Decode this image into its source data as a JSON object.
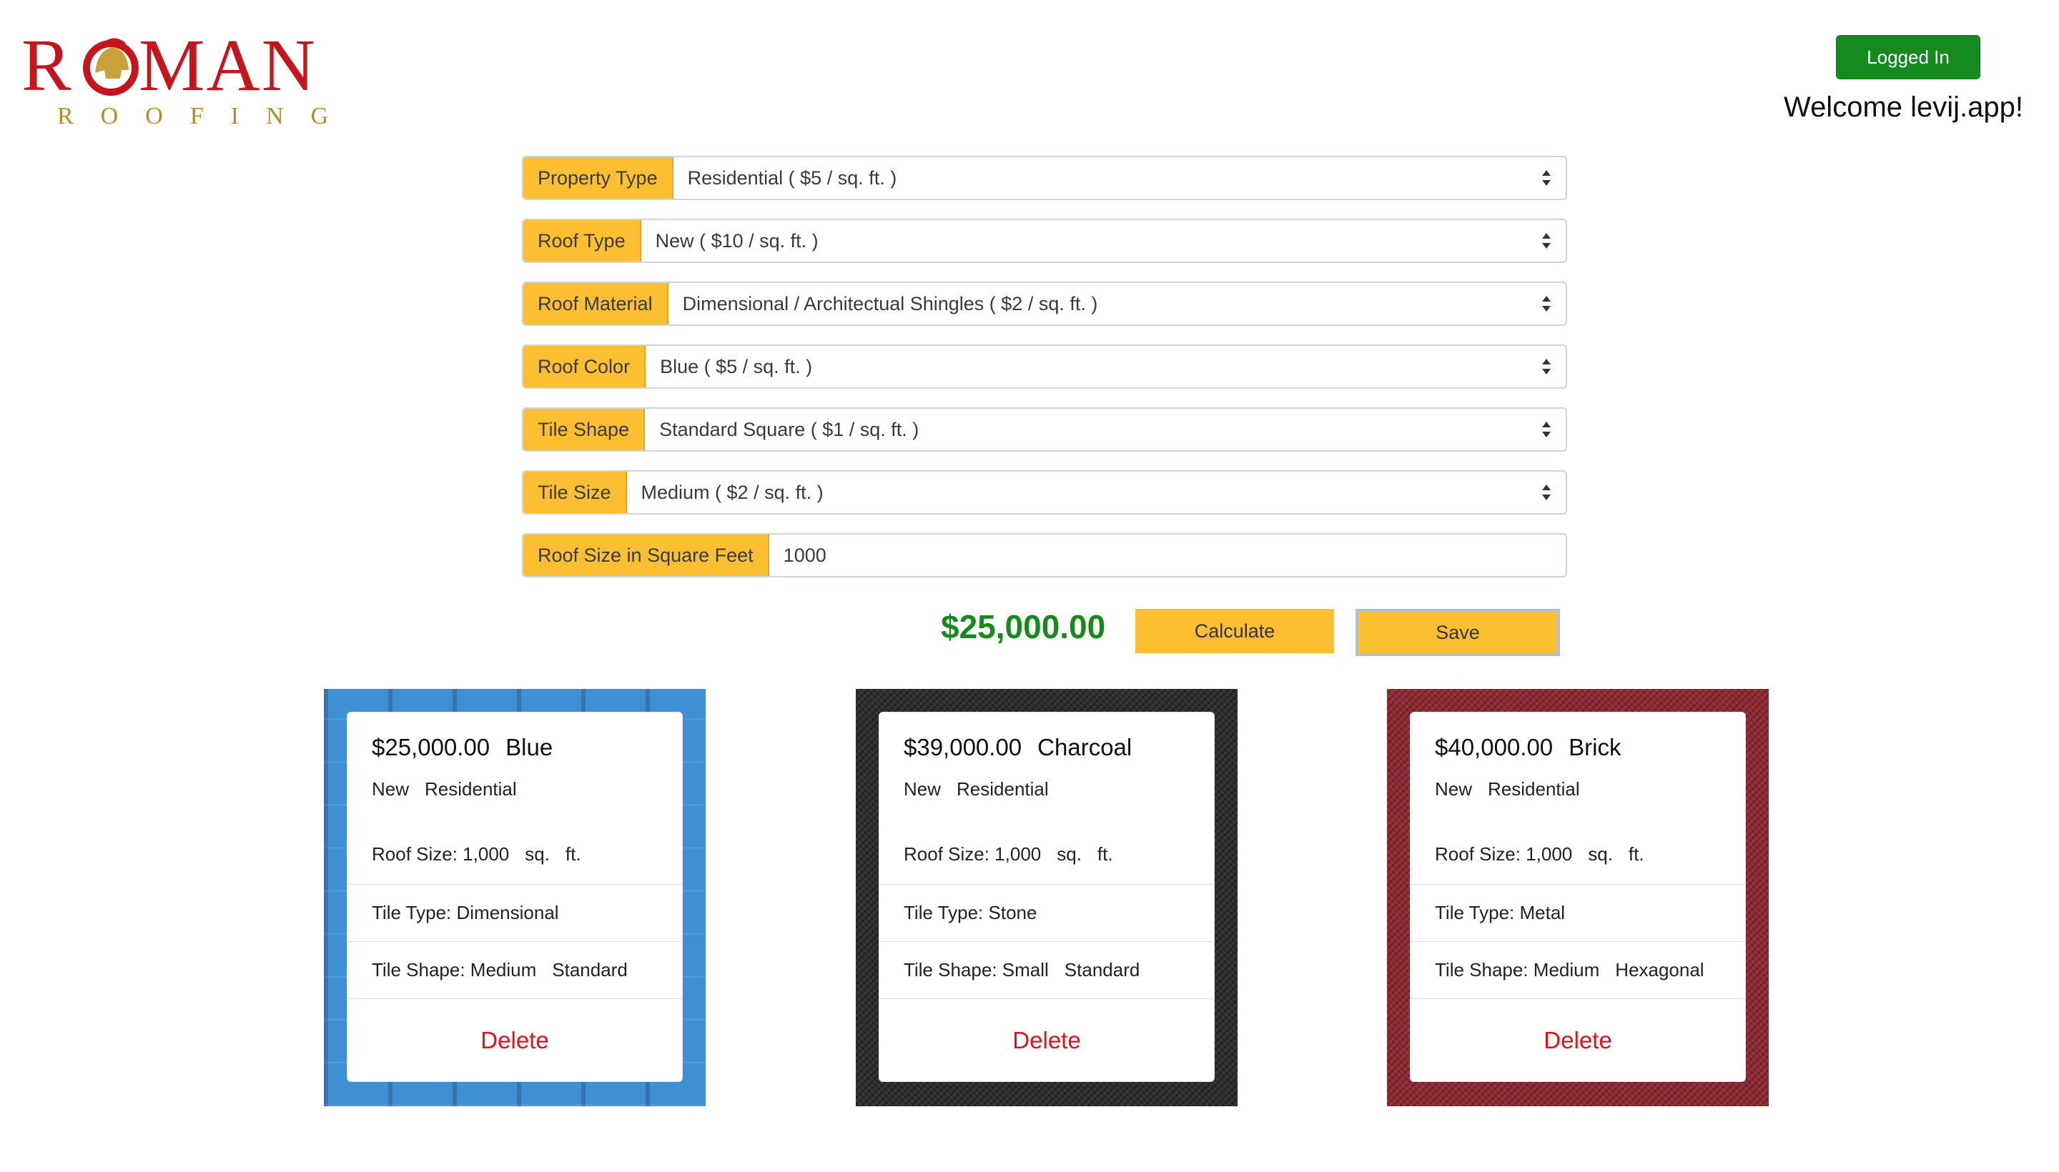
{
  "logo": {
    "top": "ROMAN",
    "bottom": "ROOFING"
  },
  "header": {
    "logged_in_label": "Logged In",
    "welcome_text": "Welcome levij.app!"
  },
  "form": {
    "fields": [
      {
        "label": "Property Type",
        "value": "Residential ( $5 / sq. ft. )"
      },
      {
        "label": "Roof Type",
        "value": "New ( $10 / sq. ft. )"
      },
      {
        "label": "Roof Material",
        "value": "Dimensional / Architectual Shingles ( $2 / sq. ft. )"
      },
      {
        "label": "Roof Color",
        "value": "Blue ( $5 / sq. ft. )"
      },
      {
        "label": "Tile Shape",
        "value": "Standard Square ( $1 / sq. ft. )"
      },
      {
        "label": "Tile Size",
        "value": "Medium ( $2 / sq. ft. )"
      }
    ],
    "roof_size": {
      "label": "Roof Size in Square Feet",
      "value": "1000"
    }
  },
  "actions": {
    "total": "$25,000.00",
    "calculate_label": "Calculate",
    "save_label": "Save"
  },
  "colors": {
    "accent": "#fcbf31",
    "total_green": "#178a1c",
    "logged_in_green": "#158a1f",
    "delete_red": "#e3101c"
  },
  "cards": [
    {
      "price": "$25,000.00",
      "color": "Blue",
      "roof_type": "New",
      "property": "Residential",
      "size_label": "Roof Size: 1,000",
      "sq": "sq.",
      "ft": "ft.",
      "tile_type": "Tile Type: Dimensional",
      "tile_shape_label": "Tile Shape: Medium",
      "tile_shape": "Standard",
      "delete_label": "Delete"
    },
    {
      "price": "$39,000.00",
      "color": "Charcoal",
      "roof_type": "New",
      "property": "Residential",
      "size_label": "Roof Size: 1,000",
      "sq": "sq.",
      "ft": "ft.",
      "tile_type": "Tile Type: Stone",
      "tile_shape_label": "Tile Shape: Small",
      "tile_shape": "Standard",
      "delete_label": "Delete"
    },
    {
      "price": "$40,000.00",
      "color": "Brick",
      "roof_type": "New",
      "property": "Residential",
      "size_label": "Roof Size: 1,000",
      "sq": "sq.",
      "ft": "ft.",
      "tile_type": "Tile Type: Metal",
      "tile_shape_label": "Tile Shape: Medium",
      "tile_shape": "Hexagonal",
      "delete_label": "Delete"
    }
  ]
}
